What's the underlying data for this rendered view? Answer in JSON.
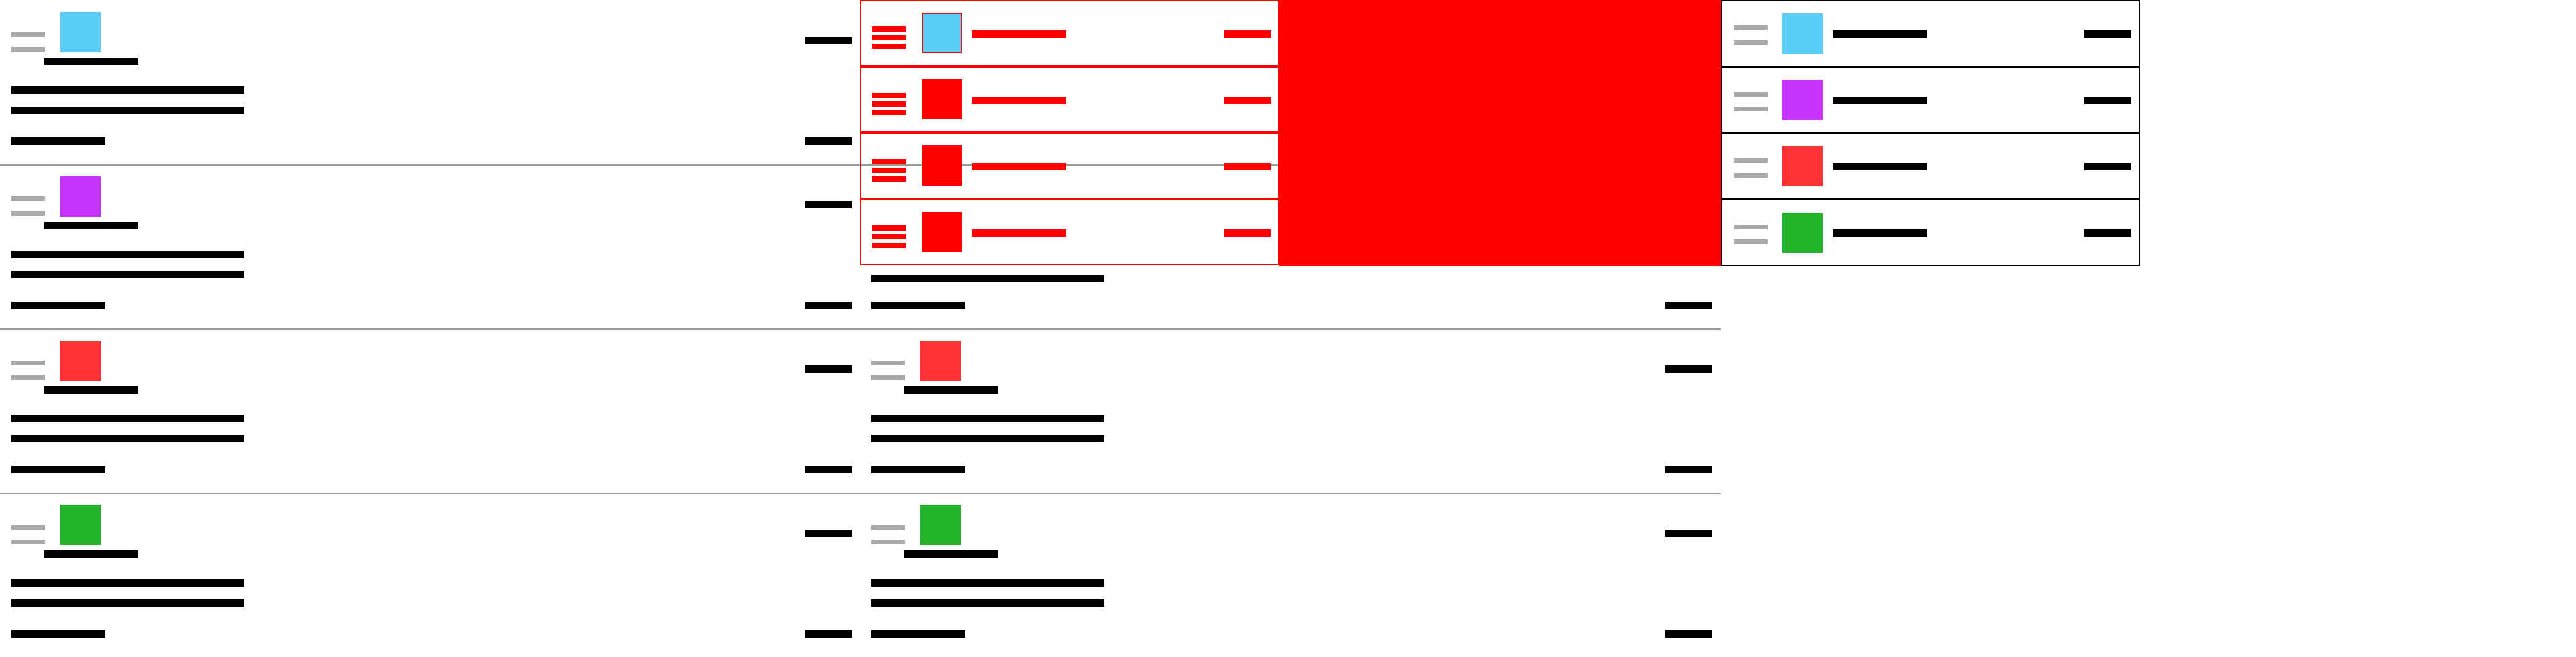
{
  "colors": {
    "cyan": "#5bcdf9",
    "purple": "#c733ff",
    "red": "#ff3434",
    "green": "#22b42a",
    "ghost": "#ff0000",
    "line": "#999999"
  },
  "left_list": {
    "items": [
      {
        "color": "#5bcdf9",
        "icon": "grip-icon"
      },
      {
        "color": "#c733ff",
        "icon": "grip-icon"
      },
      {
        "color": "#ff3434",
        "icon": "grip-icon"
      },
      {
        "color": "#22b42a",
        "icon": "grip-icon"
      }
    ]
  },
  "middle_list": {
    "items": [
      {
        "color": "#ff3434",
        "icon": "grip-icon"
      },
      {
        "color": "#22b42a",
        "icon": "grip-icon"
      }
    ]
  },
  "drag_ghost": {
    "rows": [
      {
        "color": "#5bcdf9"
      },
      {
        "color": "#ff0000"
      },
      {
        "color": "#ff0000"
      },
      {
        "color": "#ff0000"
      }
    ]
  },
  "drop_list": {
    "items": [
      {
        "color": "#5bcdf9"
      },
      {
        "color": "#c733ff"
      },
      {
        "color": "#ff3434"
      },
      {
        "color": "#22b42a"
      }
    ]
  }
}
